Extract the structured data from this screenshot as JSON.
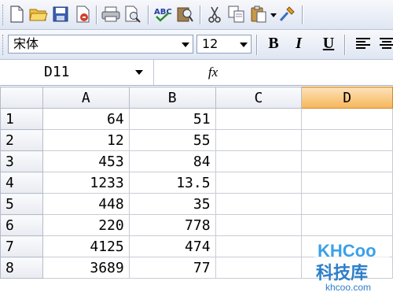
{
  "toolbar": {
    "icons": [
      "new-document-icon",
      "open-folder-icon",
      "save-icon",
      "permission-icon",
      "print-icon",
      "print-preview-icon",
      "spelling-icon",
      "research-icon",
      "cut-icon",
      "copy-icon",
      "paste-icon",
      "format-painter-icon"
    ]
  },
  "format": {
    "font_name": "宋体",
    "font_size": "12",
    "bold": "B",
    "italic": "I",
    "underline": "U"
  },
  "formula_bar": {
    "name_box": "D11",
    "fx": "fx"
  },
  "sheet": {
    "columns": [
      "A",
      "B",
      "C",
      "D"
    ],
    "active_column": "D",
    "rows": [
      {
        "num": "1",
        "a": "64",
        "b": "51"
      },
      {
        "num": "2",
        "a": "12",
        "b": "55"
      },
      {
        "num": "3",
        "a": "453",
        "b": "84"
      },
      {
        "num": "4",
        "a": "1233",
        "b": "13.5"
      },
      {
        "num": "5",
        "a": "448",
        "b": "35"
      },
      {
        "num": "6",
        "a": "220",
        "b": "778"
      },
      {
        "num": "7",
        "a": "4125",
        "b": "474"
      },
      {
        "num": "8",
        "a": "3689",
        "b": "77"
      }
    ]
  },
  "watermark": {
    "logo": "KHCoo",
    "name": "科技库",
    "url": "khcoo.com"
  },
  "colors": {
    "active_header": "#f6b55a",
    "toolbar": "#dfe6f3"
  }
}
